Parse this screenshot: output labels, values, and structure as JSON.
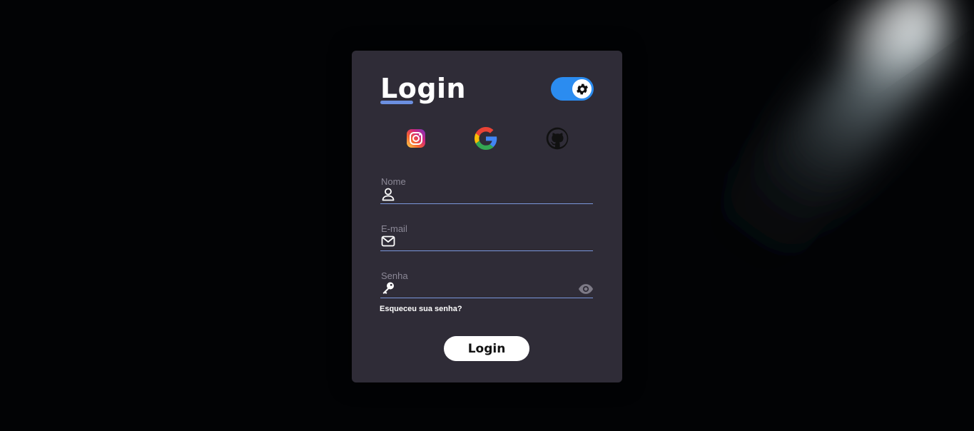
{
  "login": {
    "title": "Login",
    "fields": [
      {
        "label": "Nome",
        "value": "",
        "icon": "user-icon"
      },
      {
        "label": "E-mail",
        "value": "",
        "icon": "mail-icon"
      },
      {
        "label": "Senha",
        "value": "",
        "icon": "key-icon"
      }
    ],
    "forgot_link": "Esqueceu sua senha?",
    "submit_label": "Login"
  },
  "social": {
    "icons": [
      "instagram-icon",
      "google-icon",
      "github-icon"
    ]
  },
  "theme_toggle": {
    "state": "on",
    "icon": "gear-icon"
  },
  "colors": {
    "background": "#000000",
    "card": "#2f2c37",
    "accent": "#2b8cf0",
    "underline": "#7a97db",
    "label": "#8b8896"
  }
}
